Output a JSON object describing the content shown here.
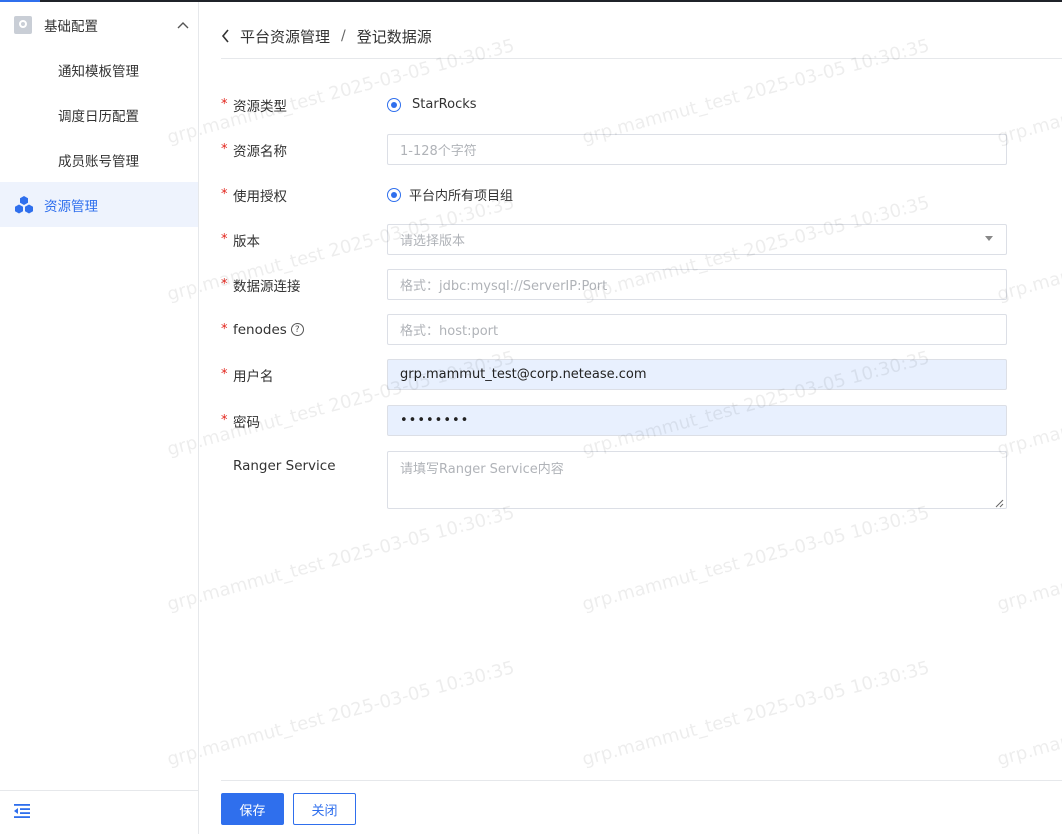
{
  "sidebar": {
    "group": {
      "label": "基础配置",
      "icon": "settings-box-icon"
    },
    "sub_items": [
      {
        "label": "通知模板管理"
      },
      {
        "label": "调度日历配置"
      },
      {
        "label": "成员账号管理"
      }
    ],
    "active": {
      "label": "资源管理",
      "icon": "resource-cubes-icon"
    },
    "collapse_icon": "collapse-menu-icon"
  },
  "breadcrumb": {
    "parent": "平台资源管理",
    "separator": "/",
    "current": "登记数据源"
  },
  "form": {
    "resource_type": {
      "label": "资源类型",
      "option": "StarRocks",
      "selected": true
    },
    "resource_name": {
      "label": "资源名称",
      "placeholder": "1-128个字符",
      "value": ""
    },
    "authorization": {
      "label": "使用授权",
      "option": "平台内所有项目组",
      "selected": true
    },
    "version": {
      "label": "版本",
      "placeholder": "请选择版本"
    },
    "connection": {
      "label": "数据源连接",
      "placeholder": "格式：jdbc:mysql://ServerIP:Port"
    },
    "fenodes": {
      "label": "fenodes",
      "placeholder": "格式：host:port",
      "help": "?"
    },
    "username": {
      "label": "用户名",
      "value": "grp.mammut_test@corp.netease.com"
    },
    "password": {
      "label": "密码",
      "value": "••••••••"
    },
    "ranger": {
      "label": "Ranger Service",
      "placeholder": "请填写Ranger Service内容"
    }
  },
  "buttons": {
    "save": "保存",
    "close": "关闭"
  },
  "watermark": "grp.mammut_test 2025-03-05 10:30:35",
  "colors": {
    "accent": "#2f6fed",
    "required": "#e2231a",
    "autofill": "#e8f0fe"
  }
}
